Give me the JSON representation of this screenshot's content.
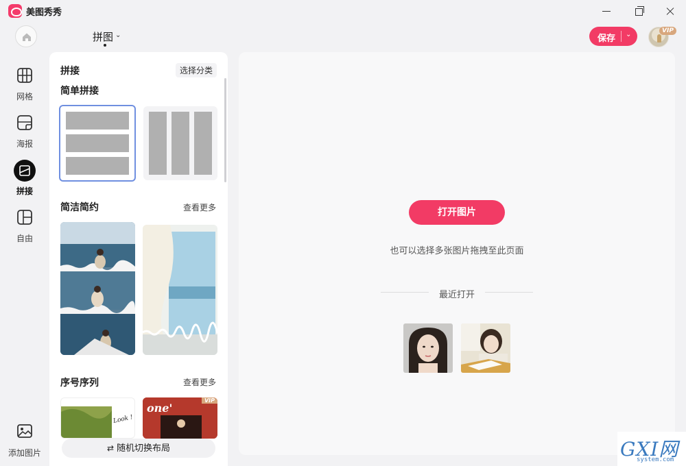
{
  "app": {
    "name": "美图秀秀"
  },
  "header": {
    "mode_title": "拼图",
    "save_label": "保存",
    "vip_label": "VIP"
  },
  "rail": {
    "items": [
      {
        "label": "网格",
        "icon": "grid-icon"
      },
      {
        "label": "海报",
        "icon": "poster-icon"
      },
      {
        "label": "拼接",
        "icon": "splice-icon",
        "active": true
      },
      {
        "label": "自由",
        "icon": "free-layout-icon"
      }
    ],
    "add_label": "添加图片"
  },
  "panel": {
    "title": "拼接",
    "category_button": "选择分类",
    "sections": [
      {
        "title": "简单拼接"
      },
      {
        "title": "简洁简约",
        "more": "查看更多"
      },
      {
        "title": "序号序列",
        "more": "查看更多"
      }
    ],
    "thumb_text": {
      "poster_word": "one'",
      "note_word": "Look !",
      "vip": "VIP"
    },
    "shuffle_label": "随机切换布局"
  },
  "canvas": {
    "open_button": "打开图片",
    "drag_hint": "也可以选择多张图片拖拽至此页面",
    "recent_title": "最近打开"
  },
  "watermark": {
    "main": "GXI网",
    "sub": "system.com"
  },
  "colors": {
    "accent": "#f23b65",
    "selected_border": "#6f8fe0",
    "vip": "#d8a77d"
  }
}
